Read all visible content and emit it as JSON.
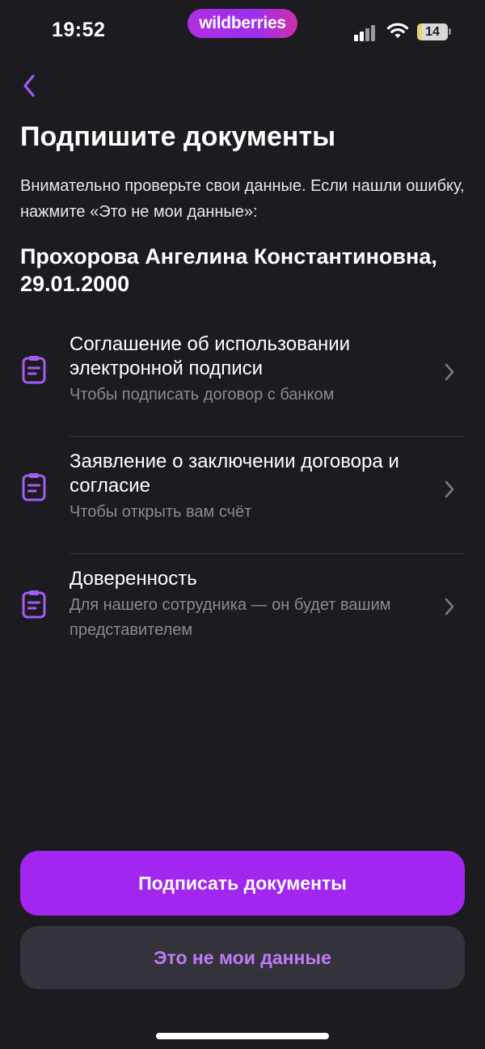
{
  "status_bar": {
    "time": "19:52",
    "brand": "wildberries",
    "battery": "14",
    "icons": [
      "signal-icon",
      "wifi-icon",
      "battery-icon"
    ]
  },
  "nav": {
    "back_icon": "chevron-left-icon"
  },
  "header": {
    "title": "Подпишите документы",
    "subtitle": "Внимательно проверьте свои данные. Если нашли ошибку, нажмите «Это не мои данные»:"
  },
  "person": {
    "name_line": "Прохорова Ангелина Константиновна,",
    "birth_date": "29.01.2000"
  },
  "documents": [
    {
      "title": "Соглашение об использовании электронной подписи",
      "description": "Чтобы подписать договор с банком",
      "icon": "clipboard-icon"
    },
    {
      "title": "Заявление о заключении договора и согласие",
      "description": "Чтобы открыть вам счёт",
      "icon": "clipboard-icon"
    },
    {
      "title": "Доверенность",
      "description": "Для нашего сотрудника — он будет вашим представителем",
      "icon": "clipboard-icon"
    }
  ],
  "actions": {
    "primary": "Подписать документы",
    "secondary": "Это не мои данные"
  },
  "colors": {
    "background": "#1c1b20",
    "accent": "#a326f0",
    "secondary_text": "#8b8993",
    "secondary_button_bg": "#34333b",
    "secondary_button_text": "#bd7bf5"
  }
}
